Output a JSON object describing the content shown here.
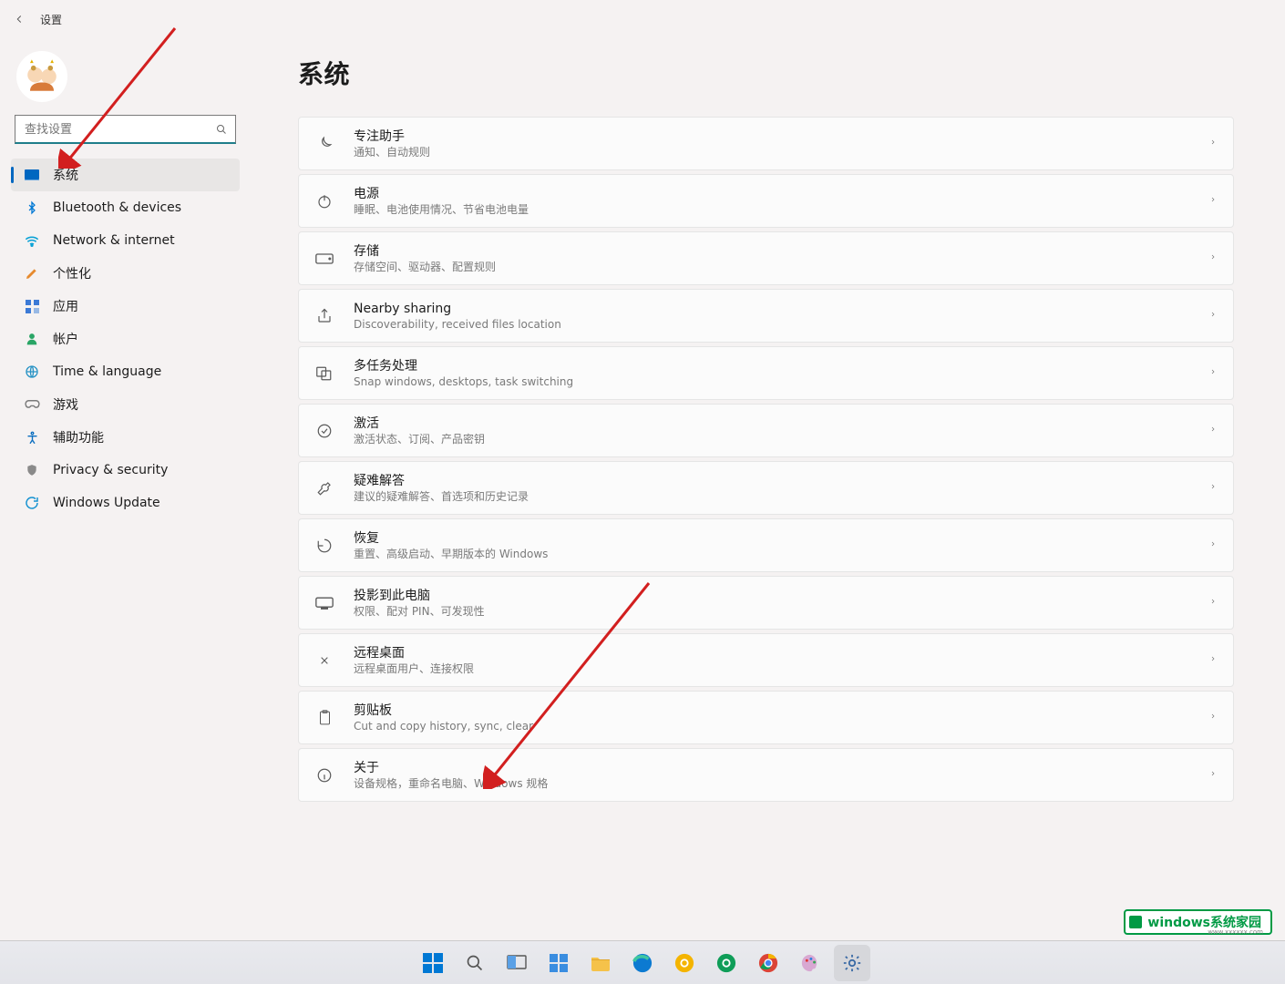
{
  "app": {
    "title": "设置"
  },
  "search": {
    "placeholder": "查找设置"
  },
  "sidebar": {
    "selected_index": 0,
    "items": [
      {
        "key": "system",
        "label": "系统"
      },
      {
        "key": "bt",
        "label": "Bluetooth & devices"
      },
      {
        "key": "net",
        "label": "Network & internet"
      },
      {
        "key": "person",
        "label": "个性化"
      },
      {
        "key": "apps",
        "label": "应用"
      },
      {
        "key": "acct",
        "label": "帐户"
      },
      {
        "key": "time",
        "label": "Time & language"
      },
      {
        "key": "game",
        "label": "游戏"
      },
      {
        "key": "access",
        "label": "辅助功能"
      },
      {
        "key": "priv",
        "label": "Privacy & security"
      },
      {
        "key": "update",
        "label": "Windows Update"
      }
    ]
  },
  "main": {
    "page_title": "系统",
    "cards": [
      {
        "icon": "moon",
        "title": "专注助手",
        "subtitle": "通知、自动规则"
      },
      {
        "icon": "power",
        "title": "电源",
        "subtitle": "睡眠、电池使用情况、节省电池电量"
      },
      {
        "icon": "drive",
        "title": "存储",
        "subtitle": "存储空间、驱动器、配置规则"
      },
      {
        "icon": "share",
        "title": "Nearby sharing",
        "subtitle": "Discoverability, received files location"
      },
      {
        "icon": "multitask",
        "title": "多任务处理",
        "subtitle": "Snap windows, desktops, task switching"
      },
      {
        "icon": "check",
        "title": "激活",
        "subtitle": "激活状态、订阅、产品密钥"
      },
      {
        "icon": "wrench",
        "title": "疑难解答",
        "subtitle": "建议的疑难解答、首选项和历史记录"
      },
      {
        "icon": "recovery",
        "title": "恢复",
        "subtitle": "重置、高级启动、早期版本的 Windows"
      },
      {
        "icon": "projector",
        "title": "投影到此电脑",
        "subtitle": "权限、配对 PIN、可发现性"
      },
      {
        "icon": "remote",
        "title": "远程桌面",
        "subtitle": "远程桌面用户、连接权限"
      },
      {
        "icon": "clipboard",
        "title": "剪贴板",
        "subtitle": "Cut and copy history, sync, clear"
      },
      {
        "icon": "info",
        "title": "关于",
        "subtitle": "设备规格，重命名电脑、Windows 规格"
      }
    ]
  },
  "taskbar": {
    "items": [
      "start",
      "search",
      "taskview",
      "widgets",
      "explorer",
      "edge",
      "chrome-yellow",
      "chrome-green",
      "chrome",
      "paint",
      "settings"
    ],
    "active_index": 10
  },
  "watermark": {
    "text": "windows系统家园",
    "url": "www.xxxxxx.com"
  },
  "colors": {
    "accent": "#0067c0",
    "card_bg": "#fbfbfb",
    "muted": "#7a7a7a",
    "annotation_red": "#d21f1f"
  }
}
